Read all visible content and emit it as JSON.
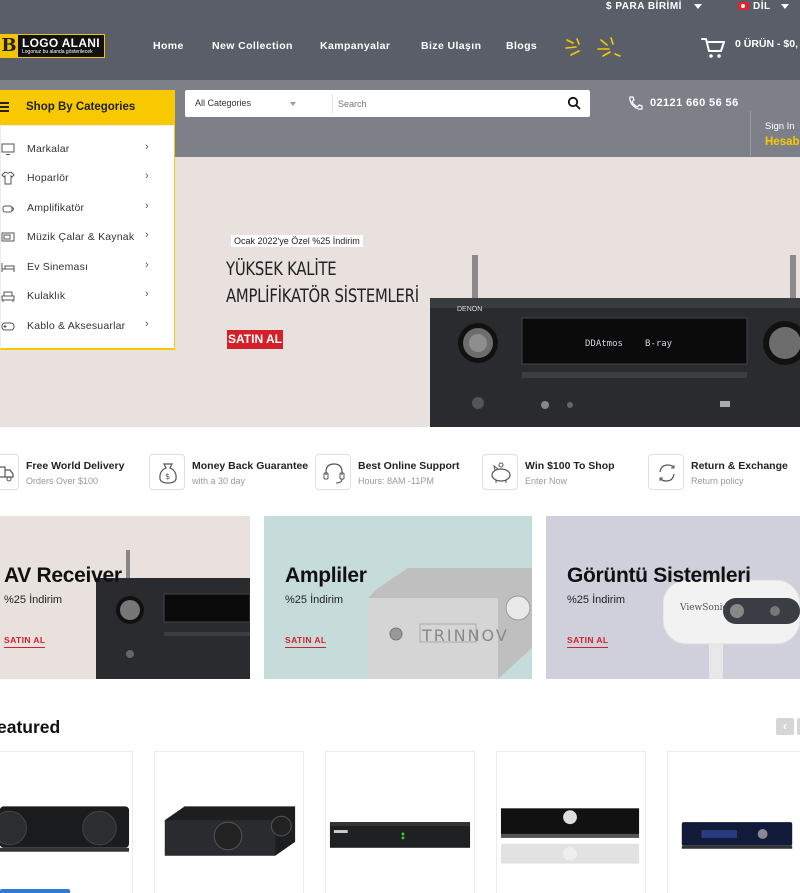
{
  "topbar": {
    "currency_label": "$ PARA BİRİMİ",
    "language_label": "DİL"
  },
  "logo": {
    "letter": "B",
    "title": "LOGO ALANI",
    "subtitle": "Logonuz bu alanda gösterilecek"
  },
  "nav": {
    "items": [
      "Home",
      "New Collection",
      "Kampanyalar",
      "Bize Ulaşın",
      "Blogs"
    ]
  },
  "cart": {
    "summary": "0 ÜRÜN - $0,"
  },
  "categories": {
    "heading": "Shop By Categories",
    "items": [
      {
        "label": "Markalar",
        "icon": "monitor-icon"
      },
      {
        "label": "Hoparlör",
        "icon": "shirt-icon"
      },
      {
        "label": "Amplifikatör",
        "icon": "cup-icon"
      },
      {
        "label": "Müzik Çalar & Kaynak",
        "icon": "microwave-icon"
      },
      {
        "label": "Ev Sineması",
        "icon": "bed-icon"
      },
      {
        "label": "Kulaklık",
        "icon": "armchair-icon"
      },
      {
        "label": "Kablo & Aksesuarlar",
        "icon": "gamepad-icon"
      }
    ]
  },
  "search": {
    "category": "All Categories",
    "placeholder": "Search"
  },
  "contact": {
    "phone": "02121 660 56 56"
  },
  "account": {
    "signin": "Sign In",
    "label": "Hesab"
  },
  "hero": {
    "tag": "Ocak 2022'ye Özel %25 İndirim",
    "title_line1": "YÜKSEK KALİTE",
    "title_line2": "AMPLİFİKATÖR SİSTEMLERİ",
    "button": "SATIN AL",
    "device_brand": "DENON",
    "display_left": "DDAtmos",
    "display_right": "B-ray"
  },
  "features": [
    {
      "title": "Free World Delivery",
      "sub": "Orders Over $100",
      "icon": "truck-icon"
    },
    {
      "title": "Money Back Guarantee",
      "sub": "with a 30 day",
      "icon": "money-bag-icon"
    },
    {
      "title": "Best Online Support",
      "sub": "Hours: 8AM -11PM",
      "icon": "headset-icon"
    },
    {
      "title": "Win $100 To Shop",
      "sub": "Enter Now",
      "icon": "piggy-bank-icon"
    },
    {
      "title": "Return & Exchange",
      "sub": "Return policy",
      "icon": "refresh-icon"
    }
  ],
  "promos": [
    {
      "title": "AV Receiver",
      "sub": "%25 İndirim",
      "button": "SATIN AL",
      "bg": "#e8e1de"
    },
    {
      "title": "Ampliler",
      "sub": "%25 İndirim",
      "button": "SATIN AL",
      "bg": "#c5dcdb",
      "brand": "TRINNOV"
    },
    {
      "title": "Görüntü Sistemleri",
      "sub": "%25 İndirim",
      "button": "SATIN AL",
      "bg": "#cfd0dc",
      "brand": "ViewSonic"
    }
  ],
  "featured": {
    "title": "eatured",
    "prev": "‹"
  },
  "colors": {
    "header": "#595e69",
    "band": "#7d8089",
    "accent_yellow": "#f8c900",
    "accent_red": "#d42028"
  }
}
